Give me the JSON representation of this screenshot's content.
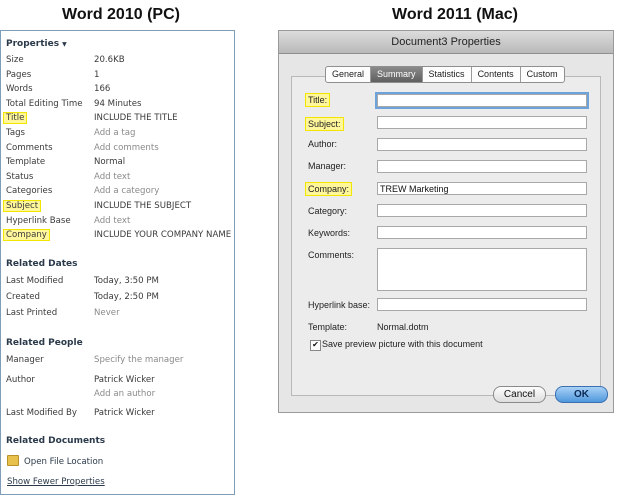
{
  "headings": {
    "left": "Word 2010 (PC)",
    "right": "Word 2011 (Mac)"
  },
  "pc": {
    "properties_title": "Properties",
    "properties": [
      {
        "label": "Size",
        "value": "20.6KB",
        "placeholder": false,
        "highlight": false
      },
      {
        "label": "Pages",
        "value": "1",
        "placeholder": false,
        "highlight": false
      },
      {
        "label": "Words",
        "value": "166",
        "placeholder": false,
        "highlight": false
      },
      {
        "label": "Total Editing Time",
        "value": "94 Minutes",
        "placeholder": false,
        "highlight": false
      },
      {
        "label": "Title",
        "value": "INCLUDE THE TITLE",
        "placeholder": false,
        "highlight": true
      },
      {
        "label": "Tags",
        "value": "Add a tag",
        "placeholder": true,
        "highlight": false
      },
      {
        "label": "Comments",
        "value": "Add comments",
        "placeholder": true,
        "highlight": false
      },
      {
        "label": "Template",
        "value": "Normal",
        "placeholder": false,
        "highlight": false
      },
      {
        "label": "Status",
        "value": "Add text",
        "placeholder": true,
        "highlight": false
      },
      {
        "label": "Categories",
        "value": "Add a category",
        "placeholder": true,
        "highlight": false
      },
      {
        "label": "Subject",
        "value": "INCLUDE THE SUBJECT",
        "placeholder": false,
        "highlight": true
      },
      {
        "label": "Hyperlink Base",
        "value": "Add text",
        "placeholder": true,
        "highlight": false
      },
      {
        "label": "Company",
        "value": "INCLUDE YOUR COMPANY NAME",
        "placeholder": false,
        "highlight": true
      }
    ],
    "related_dates_title": "Related Dates",
    "related_dates": [
      {
        "label": "Last Modified",
        "value": "Today, 3:50 PM",
        "placeholder": false
      },
      {
        "label": "Created",
        "value": "Today, 2:50 PM",
        "placeholder": false
      },
      {
        "label": "Last Printed",
        "value": "Never",
        "placeholder": true
      }
    ],
    "related_people_title": "Related People",
    "manager_label": "Manager",
    "manager_value": "Specify the manager",
    "author_label": "Author",
    "author_value": "Patrick Wicker",
    "add_author": "Add an author",
    "last_modified_by_label": "Last Modified By",
    "last_modified_by_value": "Patrick Wicker",
    "related_documents_title": "Related Documents",
    "open_file_location": "Open File Location",
    "show_fewer": "Show Fewer Properties"
  },
  "mac": {
    "window_title": "Document3 Properties",
    "tabs": [
      "General",
      "Summary",
      "Statistics",
      "Contents",
      "Custom"
    ],
    "active_tab": "Summary",
    "fields": {
      "title_label": "Title:",
      "title_value": "",
      "subject_label": "Subject:",
      "subject_value": "",
      "author_label": "Author:",
      "author_value": "",
      "manager_label": "Manager:",
      "manager_value": "",
      "company_label": "Company:",
      "company_value": "TREW Marketing",
      "category_label": "Category:",
      "category_value": "",
      "keywords_label": "Keywords:",
      "keywords_value": "",
      "comments_label": "Comments:",
      "comments_value": "",
      "hyperlink_label": "Hyperlink base:",
      "hyperlink_value": "",
      "template_label": "Template:",
      "template_value": "Normal.dotm"
    },
    "save_preview_label": "Save preview picture with this document",
    "save_preview_checked": true,
    "cancel_label": "Cancel",
    "ok_label": "OK",
    "colors": {
      "highlight": "#fff79a",
      "ok_button": "#4f97dc"
    }
  }
}
